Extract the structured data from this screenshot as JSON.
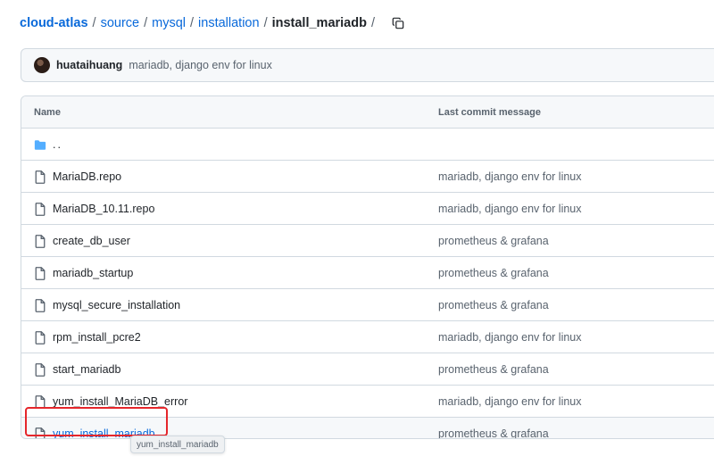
{
  "breadcrumb": {
    "root": "cloud-atlas",
    "items": [
      "source",
      "mysql",
      "installation"
    ],
    "current": "install_mariadb",
    "separator": "/"
  },
  "commit": {
    "author": "huataihuang",
    "message": "mariadb, django env for linux"
  },
  "table": {
    "headers": {
      "name": "Name",
      "message": "Last commit message"
    },
    "parent": "..",
    "rows": [
      {
        "name": "MariaDB.repo",
        "message": "mariadb, django env for linux",
        "type": "file"
      },
      {
        "name": "MariaDB_10.11.repo",
        "message": "mariadb, django env for linux",
        "type": "file"
      },
      {
        "name": "create_db_user",
        "message": "prometheus & grafana",
        "type": "file"
      },
      {
        "name": "mariadb_startup",
        "message": "prometheus & grafana",
        "type": "file"
      },
      {
        "name": "mysql_secure_installation",
        "message": "prometheus & grafana",
        "type": "file"
      },
      {
        "name": "rpm_install_pcre2",
        "message": "mariadb, django env for linux",
        "type": "file"
      },
      {
        "name": "start_mariadb",
        "message": "prometheus & grafana",
        "type": "file"
      },
      {
        "name": "yum_install_MariaDB_error",
        "message": "mariadb, django env for linux",
        "type": "file"
      },
      {
        "name": "yum_install_mariadb",
        "message": "prometheus & grafana",
        "type": "file"
      }
    ]
  },
  "tooltip": "yum_install_mariadb",
  "colors": {
    "link": "#0969da",
    "folder": "#54aeff",
    "highlight": "#e5262b"
  }
}
